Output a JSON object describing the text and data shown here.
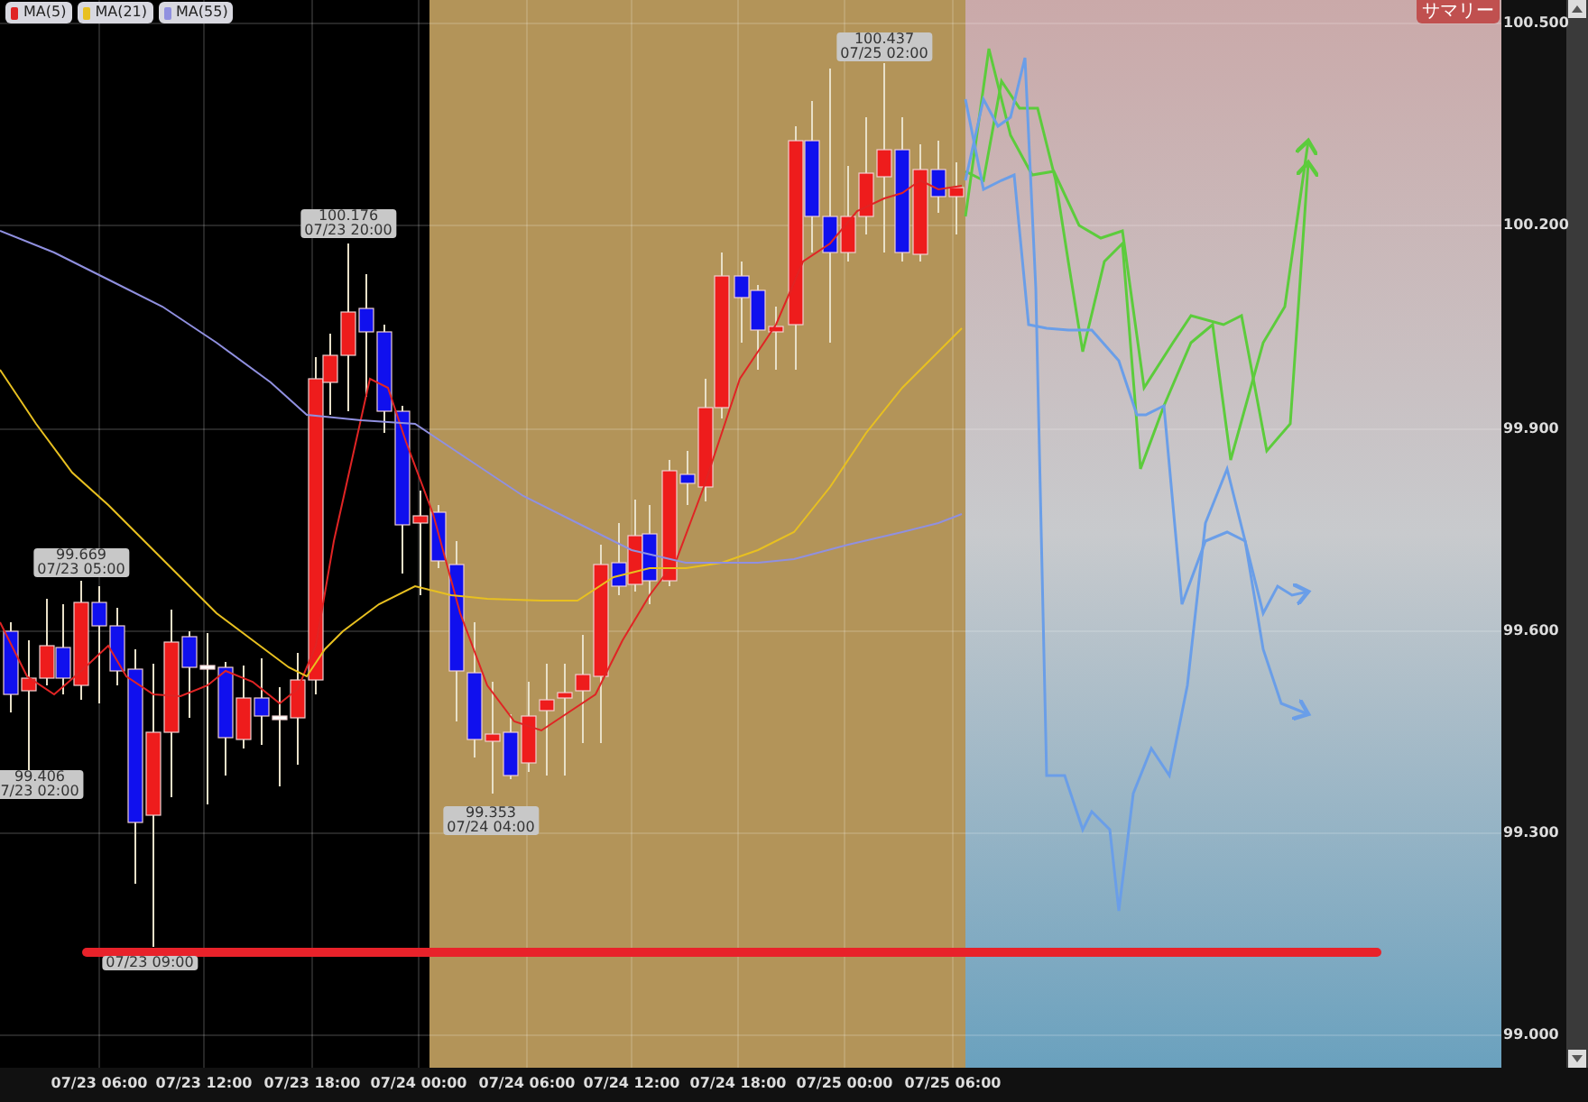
{
  "legend": [
    {
      "label": "MA(5)",
      "color": "#e02424"
    },
    {
      "label": "MA(21)",
      "color": "#e8c020"
    },
    {
      "label": "MA(55)",
      "color": "#9090e0"
    }
  ],
  "summary_button": "サマリー",
  "callouts": [
    {
      "value": "99.669",
      "time": "07/23 05:00"
    },
    {
      "value": "99.406",
      "time": "7/23 02:00"
    },
    {
      "value": "100.176",
      "time": "07/23 20:00"
    },
    {
      "value": "99.353",
      "time": "07/24 04:00"
    },
    {
      "value": "100.437",
      "time": "07/25 02:00"
    },
    {
      "time": "07/23 09:00"
    }
  ],
  "price_axis": [
    "100.500",
    "100.200",
    "99.900",
    "99.600",
    "99.300",
    "99.000"
  ],
  "time_axis": [
    "07/23 06:00",
    "07/23 12:00",
    "07/23 18:00",
    "07/24 00:00",
    "07/24 06:00",
    "07/24 12:00",
    "07/24 18:00",
    "07/25 00:00",
    "07/25 06:00"
  ]
}
